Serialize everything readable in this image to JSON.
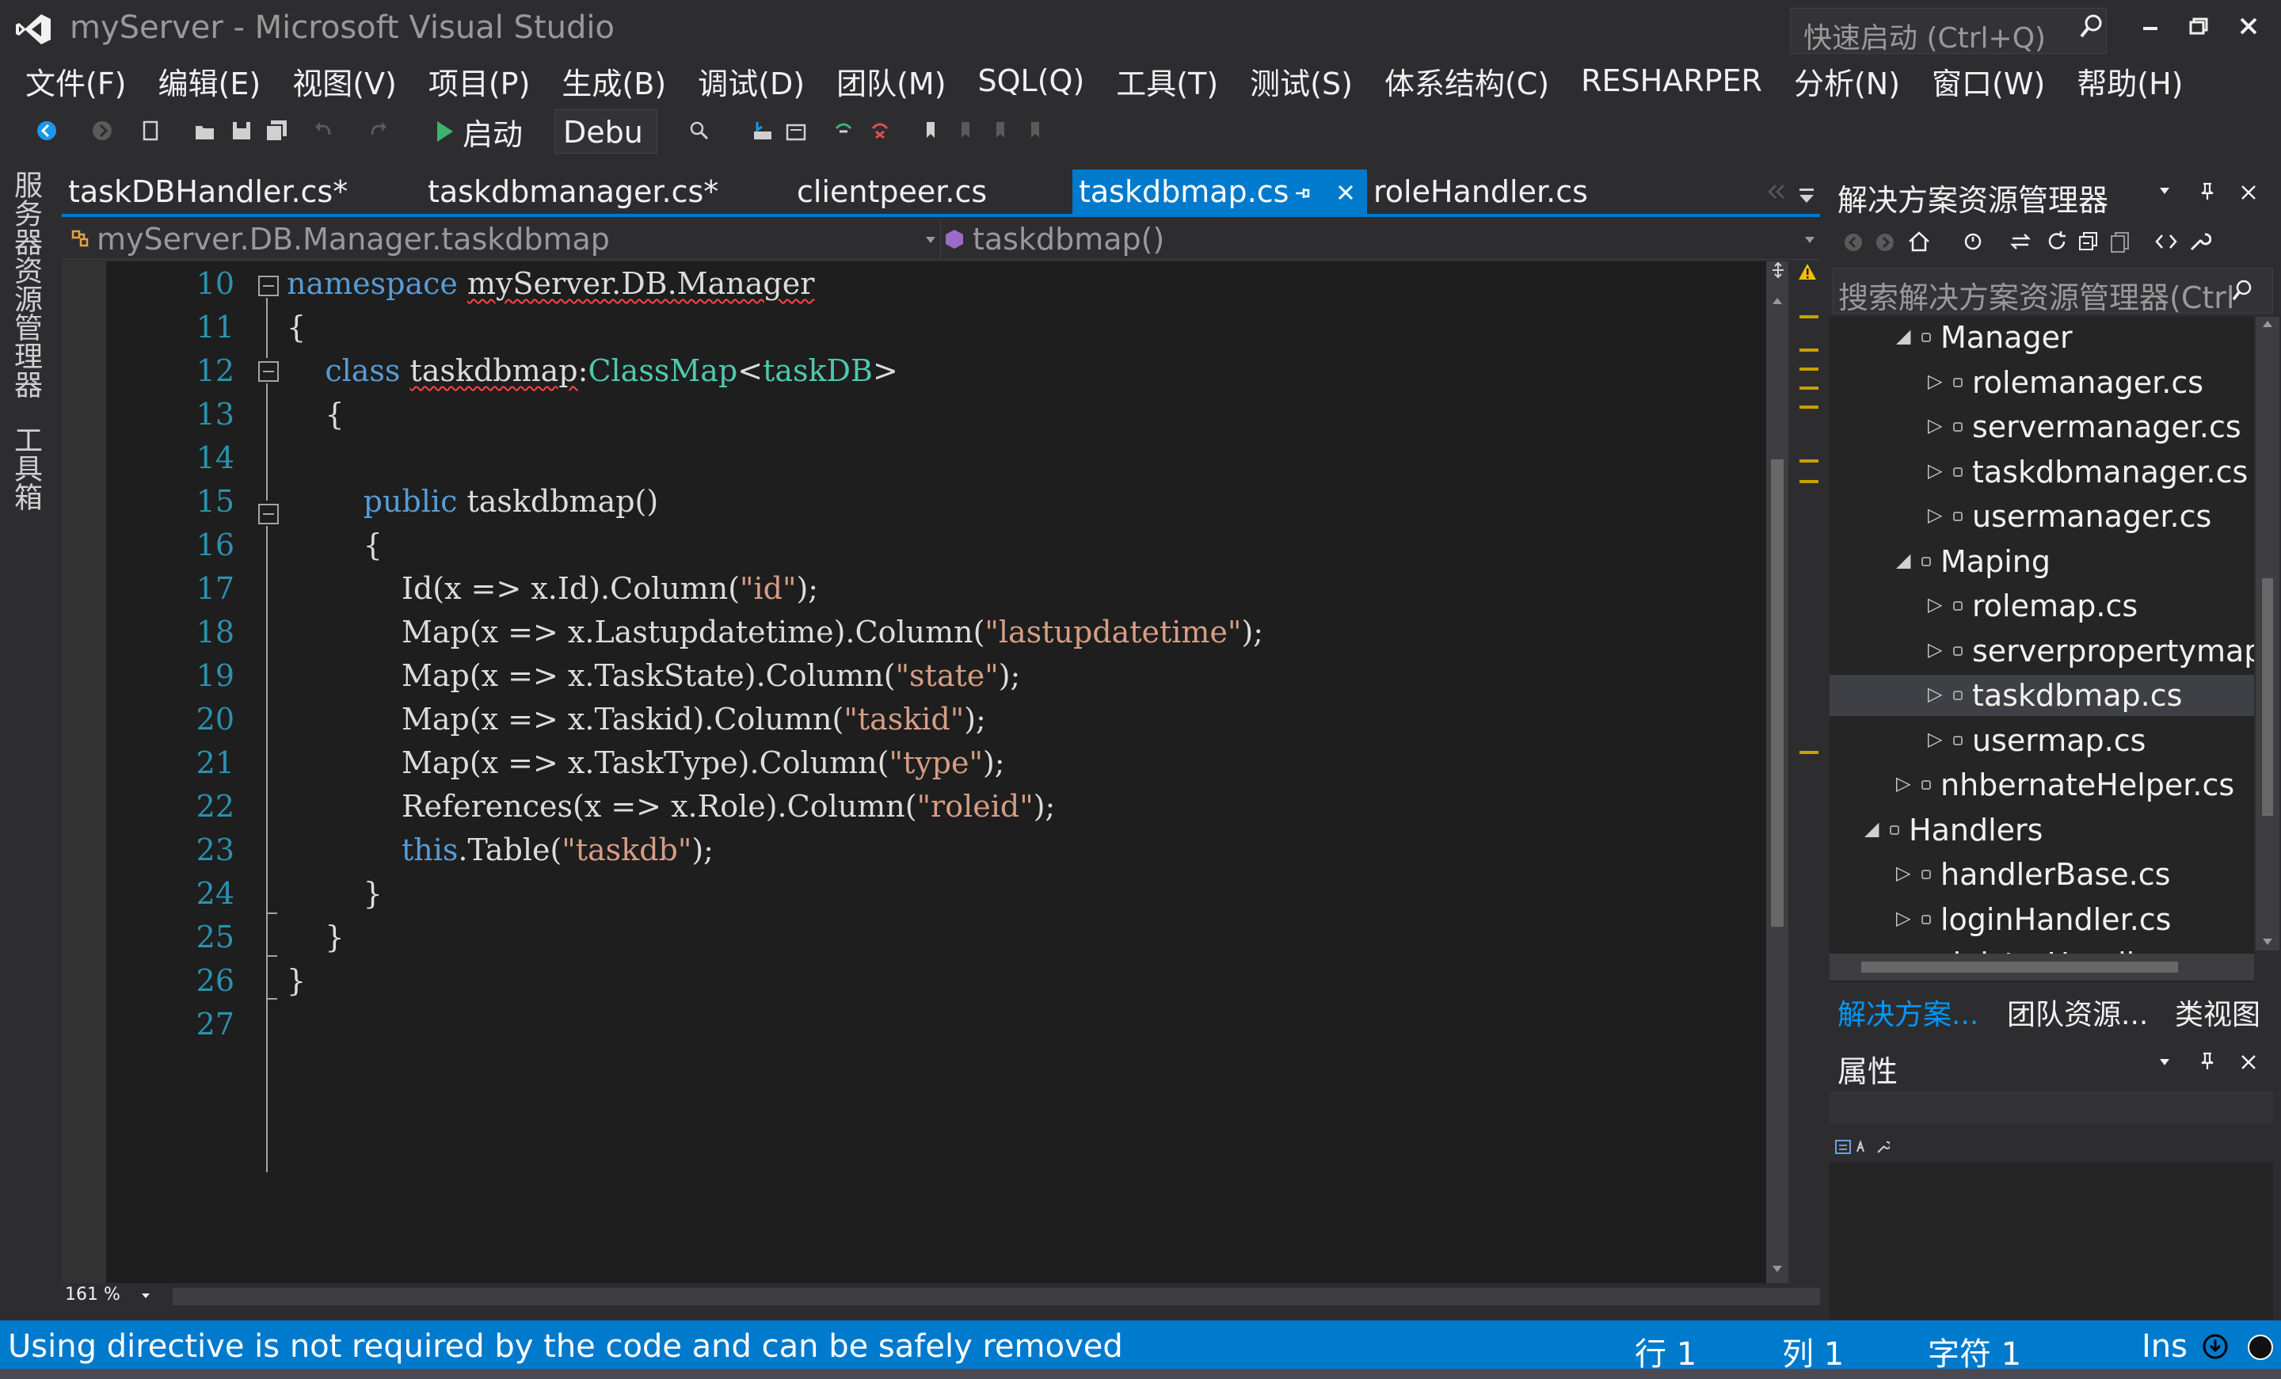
{
  "window": {
    "title": "myServer - Microsoft Visual Studio",
    "quick_launch_placeholder": "快速启动 (Ctrl+Q)"
  },
  "menu": [
    "文件(F)",
    "编辑(E)",
    "视图(V)",
    "项目(P)",
    "生成(B)",
    "调试(D)",
    "团队(M)",
    "SQL(Q)",
    "工具(T)",
    "测试(S)",
    "体系结构(C)",
    "RESHARPER",
    "分析(N)",
    "窗口(W)",
    "帮助(H)"
  ],
  "toolbar": {
    "start_label": "启动",
    "config_value": "Debu"
  },
  "side_tabs": [
    "服务器资源管理器",
    "工具箱"
  ],
  "doc_tabs": [
    {
      "label": "taskDBHandler.cs*",
      "active": false
    },
    {
      "label": "taskdbmanager.cs*",
      "active": false
    },
    {
      "label": "clientpeer.cs",
      "active": false
    },
    {
      "label": "taskdbmap.cs",
      "active": true
    },
    {
      "label": "roleHandler.cs",
      "active": false
    }
  ],
  "navbar": {
    "type": "myServer.DB.Manager.taskdbmap",
    "member": "taskdbmap()"
  },
  "editor": {
    "zoom": "161 %",
    "lines": [
      {
        "n": "10",
        "tokens": [
          [
            "kw",
            "namespace"
          ],
          [
            "id",
            " "
          ],
          [
            "squig",
            "myServer.DB.Manager"
          ]
        ]
      },
      {
        "n": "11",
        "tokens": [
          [
            "id",
            "{"
          ]
        ]
      },
      {
        "n": "12",
        "tokens": [
          [
            "id",
            "    "
          ],
          [
            "kw",
            "class"
          ],
          [
            "id",
            " "
          ],
          [
            "squig",
            "taskdbmap"
          ],
          [
            "id",
            ":"
          ],
          [
            "tp",
            "ClassMap"
          ],
          [
            "id",
            "<"
          ],
          [
            "tp",
            "taskDB"
          ],
          [
            "id",
            ">"
          ]
        ]
      },
      {
        "n": "13",
        "tokens": [
          [
            "id",
            "    {"
          ]
        ]
      },
      {
        "n": "14",
        "tokens": [
          [
            "id",
            ""
          ]
        ]
      },
      {
        "n": "15",
        "tokens": [
          [
            "id",
            "        "
          ],
          [
            "kw",
            "public"
          ],
          [
            "id",
            " taskdbmap()"
          ]
        ]
      },
      {
        "n": "16",
        "tokens": [
          [
            "id",
            "        {"
          ]
        ]
      },
      {
        "n": "17",
        "tokens": [
          [
            "id",
            "            Id(x => x.Id).Column("
          ],
          [
            "str",
            "\"id\""
          ],
          [
            "id",
            ");"
          ]
        ]
      },
      {
        "n": "18",
        "tokens": [
          [
            "id",
            "            Map(x => x.Lastupdatetime).Column("
          ],
          [
            "str",
            "\"lastupdatetime\""
          ],
          [
            "id",
            ");"
          ]
        ]
      },
      {
        "n": "19",
        "tokens": [
          [
            "id",
            "            Map(x => x.TaskState).Column("
          ],
          [
            "str",
            "\"state\""
          ],
          [
            "id",
            ");"
          ]
        ]
      },
      {
        "n": "20",
        "tokens": [
          [
            "id",
            "            Map(x => x.Taskid).Column("
          ],
          [
            "str",
            "\"taskid\""
          ],
          [
            "id",
            ");"
          ]
        ]
      },
      {
        "n": "21",
        "tokens": [
          [
            "id",
            "            Map(x => x.TaskType).Column("
          ],
          [
            "str",
            "\"type\""
          ],
          [
            "id",
            ");"
          ]
        ]
      },
      {
        "n": "22",
        "tokens": [
          [
            "id",
            "            References(x => x.Role).Column("
          ],
          [
            "str",
            "\"roleid\""
          ],
          [
            "id",
            ");"
          ]
        ]
      },
      {
        "n": "23",
        "tokens": [
          [
            "id",
            "            "
          ],
          [
            "kw",
            "this"
          ],
          [
            "id",
            ".Table("
          ],
          [
            "str",
            "\"taskdb\""
          ],
          [
            "id",
            ");"
          ]
        ]
      },
      {
        "n": "24",
        "tokens": [
          [
            "id",
            "        }"
          ]
        ]
      },
      {
        "n": "25",
        "tokens": [
          [
            "id",
            "    }"
          ]
        ]
      },
      {
        "n": "26",
        "tokens": [
          [
            "id",
            "}"
          ]
        ]
      },
      {
        "n": "27",
        "tokens": [
          [
            "id",
            ""
          ]
        ]
      }
    ]
  },
  "solution_explorer": {
    "title": "解决方案资源管理器",
    "search_placeholder": "搜索解决方案资源管理器(Ctrl",
    "items": [
      {
        "label": "Manager",
        "level": 2,
        "expanded": true,
        "folder": true
      },
      {
        "label": "rolemanager.cs",
        "level": 3
      },
      {
        "label": "servermanager.cs",
        "level": 3
      },
      {
        "label": "taskdbmanager.cs",
        "level": 3
      },
      {
        "label": "usermanager.cs",
        "level": 3
      },
      {
        "label": "Maping",
        "level": 2,
        "expanded": true,
        "folder": true
      },
      {
        "label": "rolemap.cs",
        "level": 3
      },
      {
        "label": "serverpropertymap",
        "level": 3
      },
      {
        "label": "taskdbmap.cs",
        "level": 3,
        "selected": true
      },
      {
        "label": "usermap.cs",
        "level": 3
      },
      {
        "label": "nhbernateHelper.cs",
        "level": 2
      },
      {
        "label": "Handlers",
        "level": 1,
        "expanded": true,
        "folder": true
      },
      {
        "label": "handlerBase.cs",
        "level": 2
      },
      {
        "label": "loginHandler.cs",
        "level": 2
      },
      {
        "label": "rigisterHandler.cs",
        "level": 2
      }
    ],
    "bottom_tabs": [
      "解决方案...",
      "团队资源...",
      "类视图"
    ]
  },
  "properties": {
    "title": "属性"
  },
  "status": {
    "message": "Using directive is not required by the code and can be safely removed",
    "row": "行 1",
    "col": "列 1",
    "char": "字符 1",
    "mode": "Ins"
  },
  "colors": {
    "accent": "#007acc",
    "keyword": "#569cd6",
    "type": "#4ec9b0",
    "string": "#d69d85",
    "line_number": "#2b91af"
  }
}
